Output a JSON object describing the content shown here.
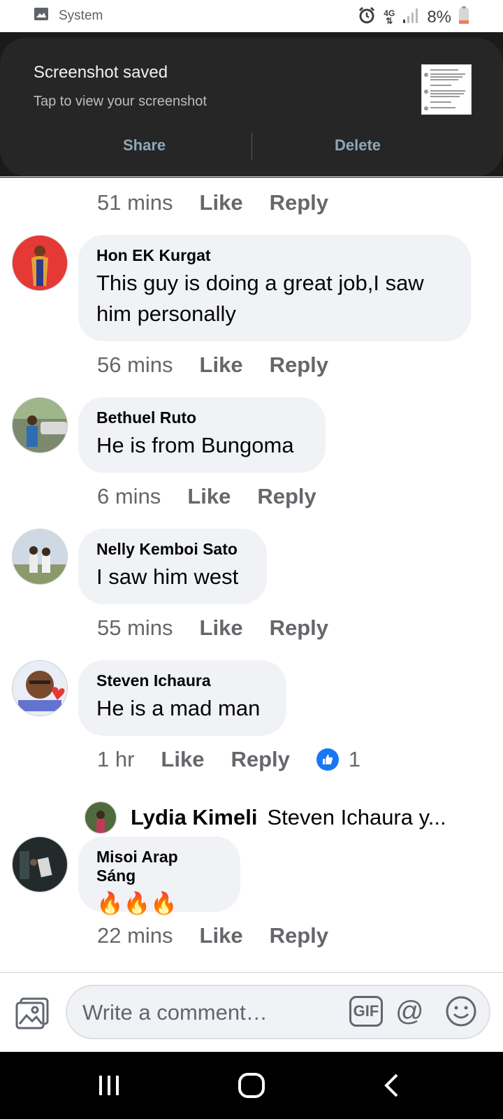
{
  "status_bar": {
    "app_label": "System",
    "network": "4G",
    "battery": "8%"
  },
  "notification": {
    "title": "Screenshot saved",
    "subtitle": "Tap to view your screenshot",
    "share_label": "Share",
    "delete_label": "Delete"
  },
  "top_meta": {
    "time": "51 mins",
    "like": "Like",
    "reply": "Reply"
  },
  "comments": [
    {
      "author": "Hon EK Kurgat",
      "text": "This guy is doing  a great  job,I saw him personally",
      "time": "56 mins",
      "like": "Like",
      "reply": "Reply"
    },
    {
      "author": "Bethuel Ruto",
      "text": "He is from Bungoma",
      "time": "6 mins",
      "like": "Like",
      "reply": "Reply"
    },
    {
      "author": "Nelly Kemboi Sato",
      "text": "I saw him west",
      "time": "55 mins",
      "like": "Like",
      "reply": "Reply"
    },
    {
      "author": "Steven Ichaura",
      "text": "He is a mad man",
      "time": "1 hr",
      "like": "Like",
      "reply": "Reply",
      "reaction_count": "1"
    },
    {
      "author": "Misoi Arap Sáng",
      "text": "🔥🔥🔥",
      "time": "22 mins",
      "like": "Like",
      "reply": "Reply"
    }
  ],
  "reply_preview": {
    "author": "Lydia Kimeli",
    "snippet": "Steven Ichaura y..."
  },
  "composer": {
    "placeholder": "Write a comment…",
    "gif_label": "GIF",
    "mention_label": "@"
  },
  "colors": {
    "bubble": "#f0f2f5",
    "meta_text": "#65676b",
    "like_blue": "#1877f2",
    "notification_bg": "#262626"
  }
}
